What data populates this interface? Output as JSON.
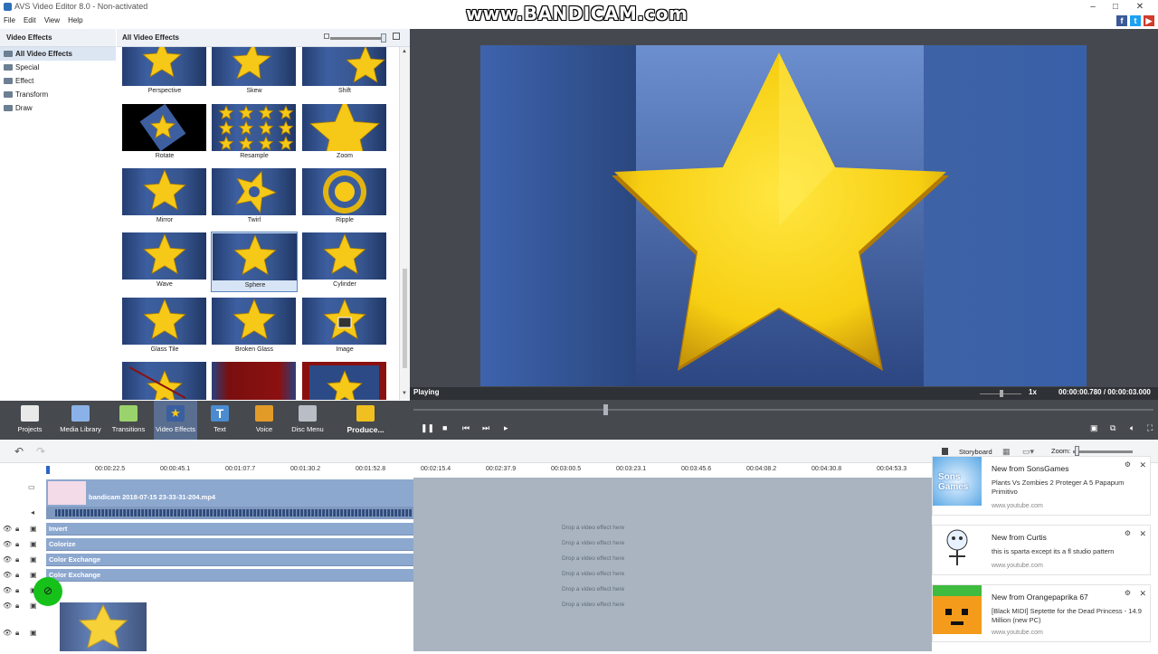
{
  "app": {
    "title": "AVS Video Editor 8.0 - Non-activated",
    "watermark": "www.BANDICAM.com"
  },
  "menu": [
    "File",
    "Edit",
    "View",
    "Help"
  ],
  "left_panel": {
    "header": "Video Effects",
    "categories": [
      "All Video Effects",
      "Special",
      "Effect",
      "Transform",
      "Draw"
    ],
    "selected_category": "All Video Effects"
  },
  "effects_panel": {
    "header": "All Video Effects",
    "effects": [
      "Perspective",
      "Skew",
      "Shift",
      "Rotate",
      "Resample",
      "Zoom",
      "Mirror",
      "Twirl",
      "Ripple",
      "Wave",
      "Sphere",
      "Cylinder",
      "Glass Tile",
      "Broken Glass",
      "Image",
      "",
      "",
      ""
    ],
    "selected": "Sphere"
  },
  "preview": {
    "status": "Playing",
    "speed": "1x",
    "time": "00:00:00.780 / 00:00:03.000"
  },
  "toolbar": {
    "buttons": [
      {
        "label": "Projects",
        "icon": "clapper-icon",
        "color": "#e9e9e9"
      },
      {
        "label": "Media Library",
        "icon": "film-icon",
        "color": "#8bb2e8"
      },
      {
        "label": "Transitions",
        "icon": "transitions-icon",
        "color": "#9ad36b"
      },
      {
        "label": "Video Effects",
        "icon": "star-icon",
        "color": "#3a5fa0"
      },
      {
        "label": "Text",
        "icon": "text-icon",
        "color": "#4a8ccf"
      },
      {
        "label": "Voice",
        "icon": "microphone-icon",
        "color": "#e39b28"
      },
      {
        "label": "Disc Menu",
        "icon": "disc-icon",
        "color": "#b9bec6"
      },
      {
        "label": "Produce...",
        "icon": "produce-icon",
        "color": "#f0c020"
      }
    ],
    "selected": "Video Effects"
  },
  "timeline": {
    "view_mode": "Storyboard",
    "zoom_label": "Zoom:",
    "ruler": [
      "00:00:22.5",
      "00:00:45.1",
      "00:01:07.7",
      "00:01:30.2",
      "00:01:52.8",
      "00:02:15.4",
      "00:02:37.9",
      "00:03:00.5",
      "00:03:23.1",
      "00:03:45.6",
      "00:04:08.2",
      "00:04:30.8",
      "00:04:53.3"
    ],
    "clip_name": "bandicam 2018-07-15 23-33-31-204.mp4",
    "effect_tracks": [
      "Invert",
      "Colorize",
      "Color Exchange",
      "Color Exchange"
    ],
    "drop_hint": "Drop a video effect here"
  },
  "notifications": [
    {
      "title": "New from SonsGames",
      "desc": "Plants Vs Zombies 2 Proteger A 5 Papapum Primitivo",
      "url": "www.youtube.com",
      "thumb_text": "Sons Games"
    },
    {
      "title": "New from Curtis",
      "desc": "this is sparta except its a fl studio pattern",
      "url": "www.youtube.com"
    },
    {
      "title": "New from Orangepaprika 67",
      "desc": "[Black MIDI] Septette for the Dead Princess - 14.9 Million (new PC)",
      "url": "www.youtube.com"
    }
  ],
  "colors": {
    "accent": "#5a6e90",
    "track_bar": "#8da8cf",
    "timeline_empty": "#a9b4c0",
    "cursor_highlight": "#16c21a"
  }
}
